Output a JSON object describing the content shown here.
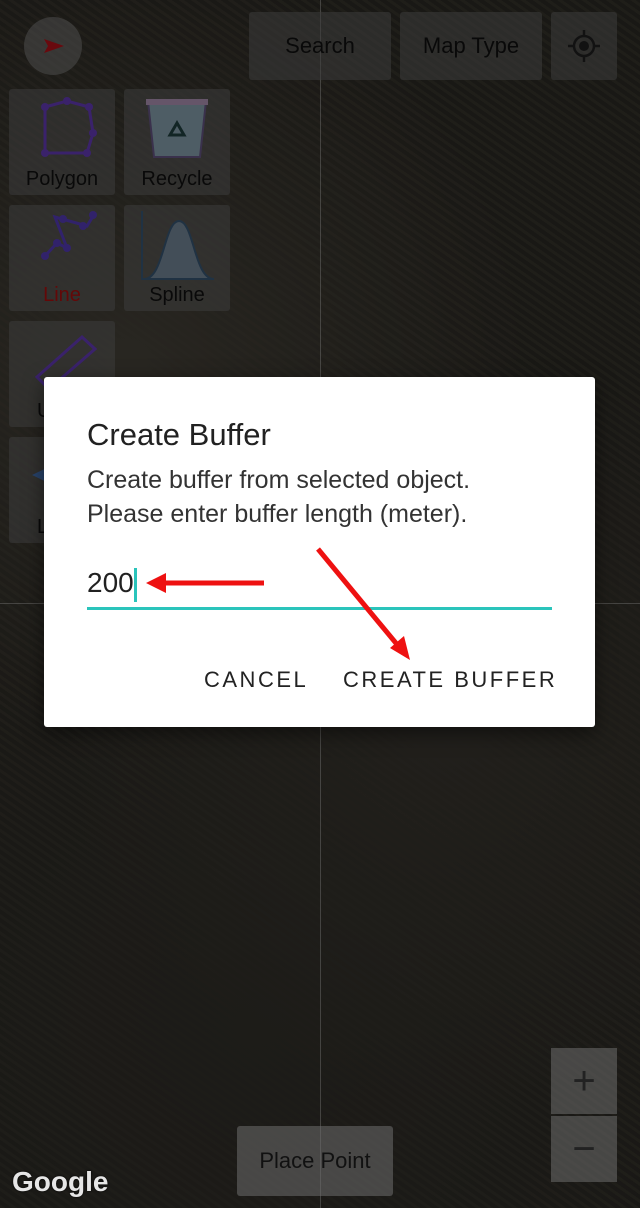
{
  "toolbar": {
    "search": "Search",
    "map_type": "Map Type"
  },
  "tools": [
    {
      "label": "Polygon"
    },
    {
      "label": "Recycle"
    },
    {
      "label": "Line",
      "color": "#cc1111"
    },
    {
      "label": "Spline"
    },
    {
      "label": "U"
    },
    {
      "label": "L"
    }
  ],
  "dialog": {
    "title": "Create Buffer",
    "message_line1": "Create buffer from selected object.",
    "message_line2": "Please enter buffer length (meter).",
    "input_value": "200",
    "cancel": "CANCEL",
    "confirm": "CREATE BUFFER"
  },
  "bottom": {
    "place_point": "Place Point",
    "zoom_in": "+",
    "zoom_out": "−",
    "logo": "Google"
  },
  "colors": {
    "accent": "#2ac4bb",
    "annotation": "#ee1111"
  }
}
